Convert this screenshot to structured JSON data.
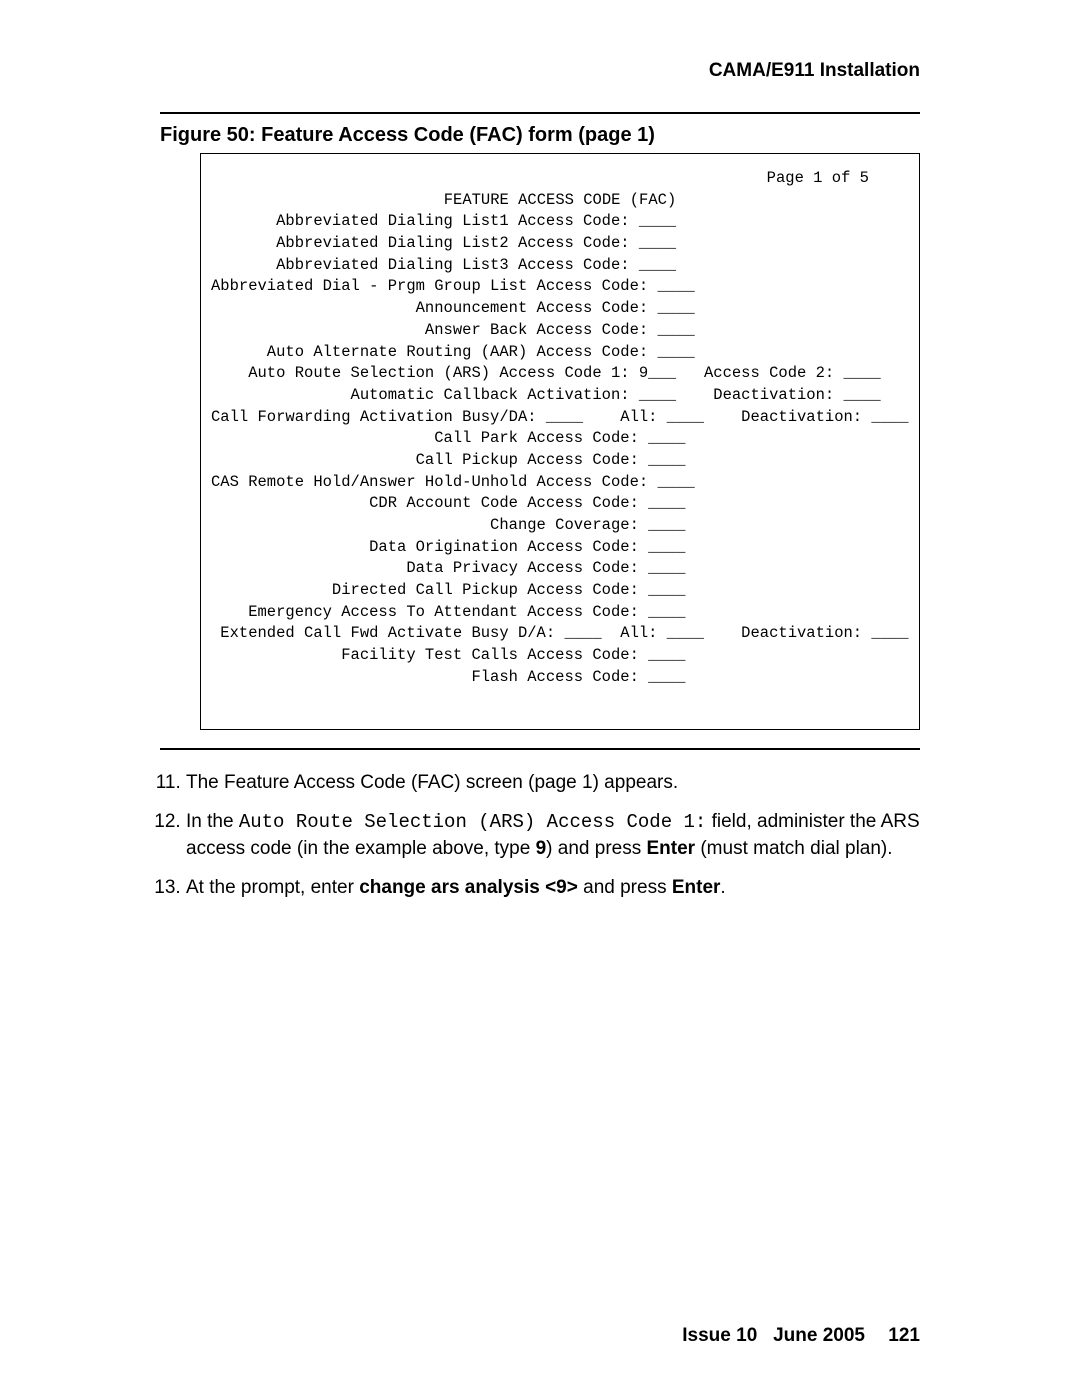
{
  "header": {
    "section": "CAMA/E911 Installation"
  },
  "figure": {
    "caption": "Figure 50: Feature Access Code (FAC) form (page 1)"
  },
  "terminal": {
    "page_indicator": "Page 1 of 5",
    "title": "FEATURE ACCESS CODE (FAC)",
    "line01": "       Abbreviated Dialing List1 Access Code: ____",
    "line02": "       Abbreviated Dialing List2 Access Code: ____",
    "line03": "       Abbreviated Dialing List3 Access Code: ____",
    "line04": "Abbreviated Dial - Prgm Group List Access Code: ____",
    "line05": "                      Announcement Access Code: ____",
    "line06": "                       Answer Back Access Code: ____",
    "line07": "      Auto Alternate Routing (AAR) Access Code: ____",
    "line08": "    Auto Route Selection (ARS) Access Code 1: 9___   Access Code 2: ____",
    "line09": "               Automatic Callback Activation: ____    Deactivation: ____",
    "line10": "Call Forwarding Activation Busy/DA: ____    All: ____    Deactivation: ____",
    "line11": "                        Call Park Access Code: ____",
    "line12": "                      Call Pickup Access Code: ____",
    "line13": "CAS Remote Hold/Answer Hold-Unhold Access Code: ____",
    "line14": "                 CDR Account Code Access Code: ____",
    "line15": "                              Change Coverage: ____",
    "line16": "                 Data Origination Access Code: ____",
    "line17": "                     Data Privacy Access Code: ____",
    "line18": "             Directed Call Pickup Access Code: ____",
    "line19": "    Emergency Access To Attendant Access Code: ____",
    "line20": " Extended Call Fwd Activate Busy D/A: ____  All: ____    Deactivation: ____",
    "line21": "              Facility Test Calls Access Code: ____",
    "line22": "                            Flash Access Code: ____"
  },
  "steps": {
    "start": 11,
    "s11": "The Feature Access Code (FAC) screen (page 1) appears.",
    "s12_a": "In the ",
    "s12_code": "Auto Route Selection (ARS) Access Code 1:",
    "s12_b": " field, administer the ARS access code (in the example above, type ",
    "s12_bold9": "9",
    "s12_c": ") and press ",
    "s12_enter": "Enter",
    "s12_d": " (must match dial plan).",
    "s13_a": "At the prompt, enter ",
    "s13_bold": "change ars analysis <9>",
    "s13_b": " and press ",
    "s13_enter": "Enter",
    "s13_c": "."
  },
  "footer": {
    "issue": "Issue 10",
    "date": "June 2005",
    "page": "121"
  }
}
